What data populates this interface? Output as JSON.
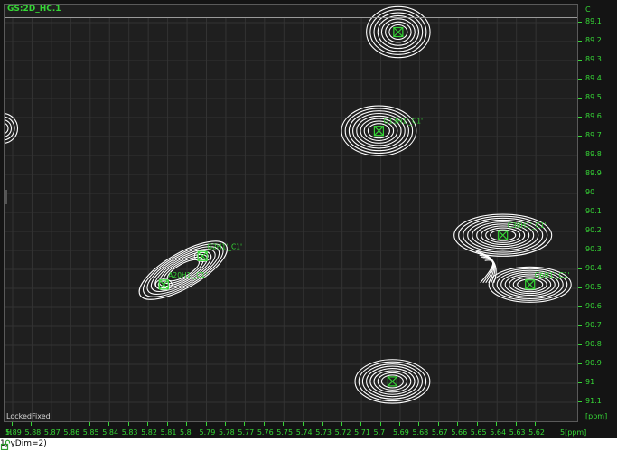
{
  "plot": {
    "title": "GS:2D_HC.1",
    "status_left": "LockedFixed",
    "accent_color": "#36d636",
    "contour_color": "#ffffff"
  },
  "y_axis": {
    "corner_label": "C",
    "unit": "[ppm]",
    "ticks": [
      "89.1",
      "89.2",
      "89.3",
      "89.4",
      "89.5",
      "89.6",
      "89.7",
      "89.8",
      "89.9",
      "90",
      "90.1",
      "90.2",
      "90.3",
      "90.4",
      "90.5",
      "90.6",
      "90.7",
      "90.8",
      "90.9",
      "91",
      "91.1"
    ]
  },
  "x_axis": {
    "prefix": "H",
    "unit": "5[ppm]",
    "ticks": [
      "5.89",
      "5.88",
      "5.87",
      "5.86",
      "5.85",
      "5.84",
      "5.83",
      "5.82",
      "5.81",
      "5.8",
      "5.79",
      "5.78",
      "5.77",
      "5.76",
      "5.75",
      "5.74",
      "5.73",
      "5.72",
      "5.71",
      "5.7",
      "5.69",
      "5.68",
      "5.67",
      "5.66",
      "5.65",
      "5.64",
      "5.63",
      "5.62"
    ]
  },
  "peaks": [
    {
      "id": "top",
      "label": "",
      "h": 5.691,
      "c": 89.15
    },
    {
      "id": "g13",
      "label": "G13H1'_C1'",
      "h": 5.701,
      "c": 89.67
    },
    {
      "id": "g2",
      "label": "G2H1'_C1'",
      "h": 5.792,
      "c": 90.33
    },
    {
      "id": "a20",
      "label": "A20H1'_C1'",
      "h": 5.812,
      "c": 90.48
    },
    {
      "id": "c30",
      "label": "C30H1'_C1'",
      "h": 5.637,
      "c": 90.22
    },
    {
      "id": "g6",
      "label": "G6H1'_C1'",
      "h": 5.623,
      "c": 90.48
    },
    {
      "id": "bottom",
      "label": "",
      "h": 5.694,
      "c": 90.99
    }
  ],
  "status_bar": {
    "text": "1, yDim=2)",
    "lock_icon": "lock-open-icon"
  }
}
